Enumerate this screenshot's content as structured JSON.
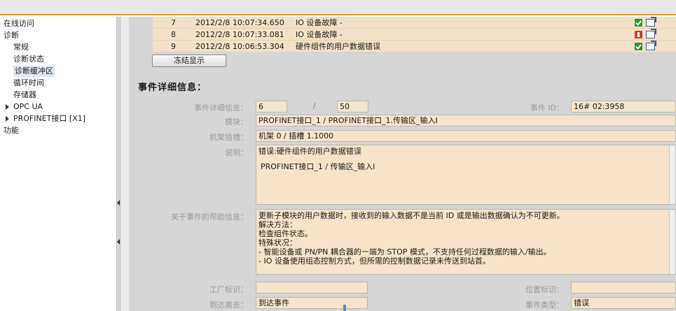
{
  "tree": {
    "items": [
      {
        "label": "在线访问"
      },
      {
        "label": "诊断"
      },
      {
        "label": "常规"
      },
      {
        "label": "诊断状态"
      },
      {
        "label": "诊断缓冲区"
      },
      {
        "label": "循环时间"
      },
      {
        "label": "存储器"
      },
      {
        "label": "OPC UA"
      },
      {
        "label": "PROFINET接口 [X1]"
      },
      {
        "label": "功能"
      }
    ]
  },
  "log": {
    "rows": [
      {
        "num": "7",
        "time": "2012/2/8 10:07:34.650",
        "event": "IO 设备故障 -",
        "status": "ok"
      },
      {
        "num": "8",
        "time": "2012/2/8 10:07:33.081",
        "event": "IO 设备故障 -",
        "status": "error"
      },
      {
        "num": "9",
        "time": "2012/2/8 10:06:53.304",
        "event": "硬件组件的用户数据错误",
        "status": "ok"
      }
    ]
  },
  "freeze_button": "冻结显示",
  "details": {
    "heading": "事件详细信息：",
    "detail_label": "事件详细信息：",
    "detail_index": "6",
    "detail_sep": "/",
    "detail_total": "50",
    "event_id_label": "事件 ID：",
    "event_id": "16# 02:3958",
    "module_label": "模块：",
    "module": "PROFINET接口_1 / PROFINET接口_1.传输区_输入I",
    "rack_label": "机架插槽：",
    "rack": "机架 0 / 插槽 1.1000",
    "desc_label": "说明：",
    "desc_line1": "错误:硬件组件的用户数据错误",
    "desc_line2": "PROFINET接口_1 / 传输区_输入I",
    "help_label": "关于事件的帮助信息：",
    "help_lines": [
      "更新子模块的用户数据时，接收到的输入数据不是当前 ID 或是输出数据确认为不可更新。",
      "解决方法：",
      "检查组件状态。",
      "特殊状况：",
      "- 智能设备或 PN/PN 耦合器的一端为 STOP 模式，不支持任何过程数据的输入/输出。",
      "- IO 设备使用组态控制方式，但所需的控制数据记录未传送到站首。"
    ],
    "plant_label": "工厂标识：",
    "plant": "",
    "location_label": "位置标识：",
    "location": "",
    "incoming_label": "到达离去：",
    "incoming": "到达事件",
    "event_type_label": "事件类型：",
    "event_type": "错误"
  }
}
